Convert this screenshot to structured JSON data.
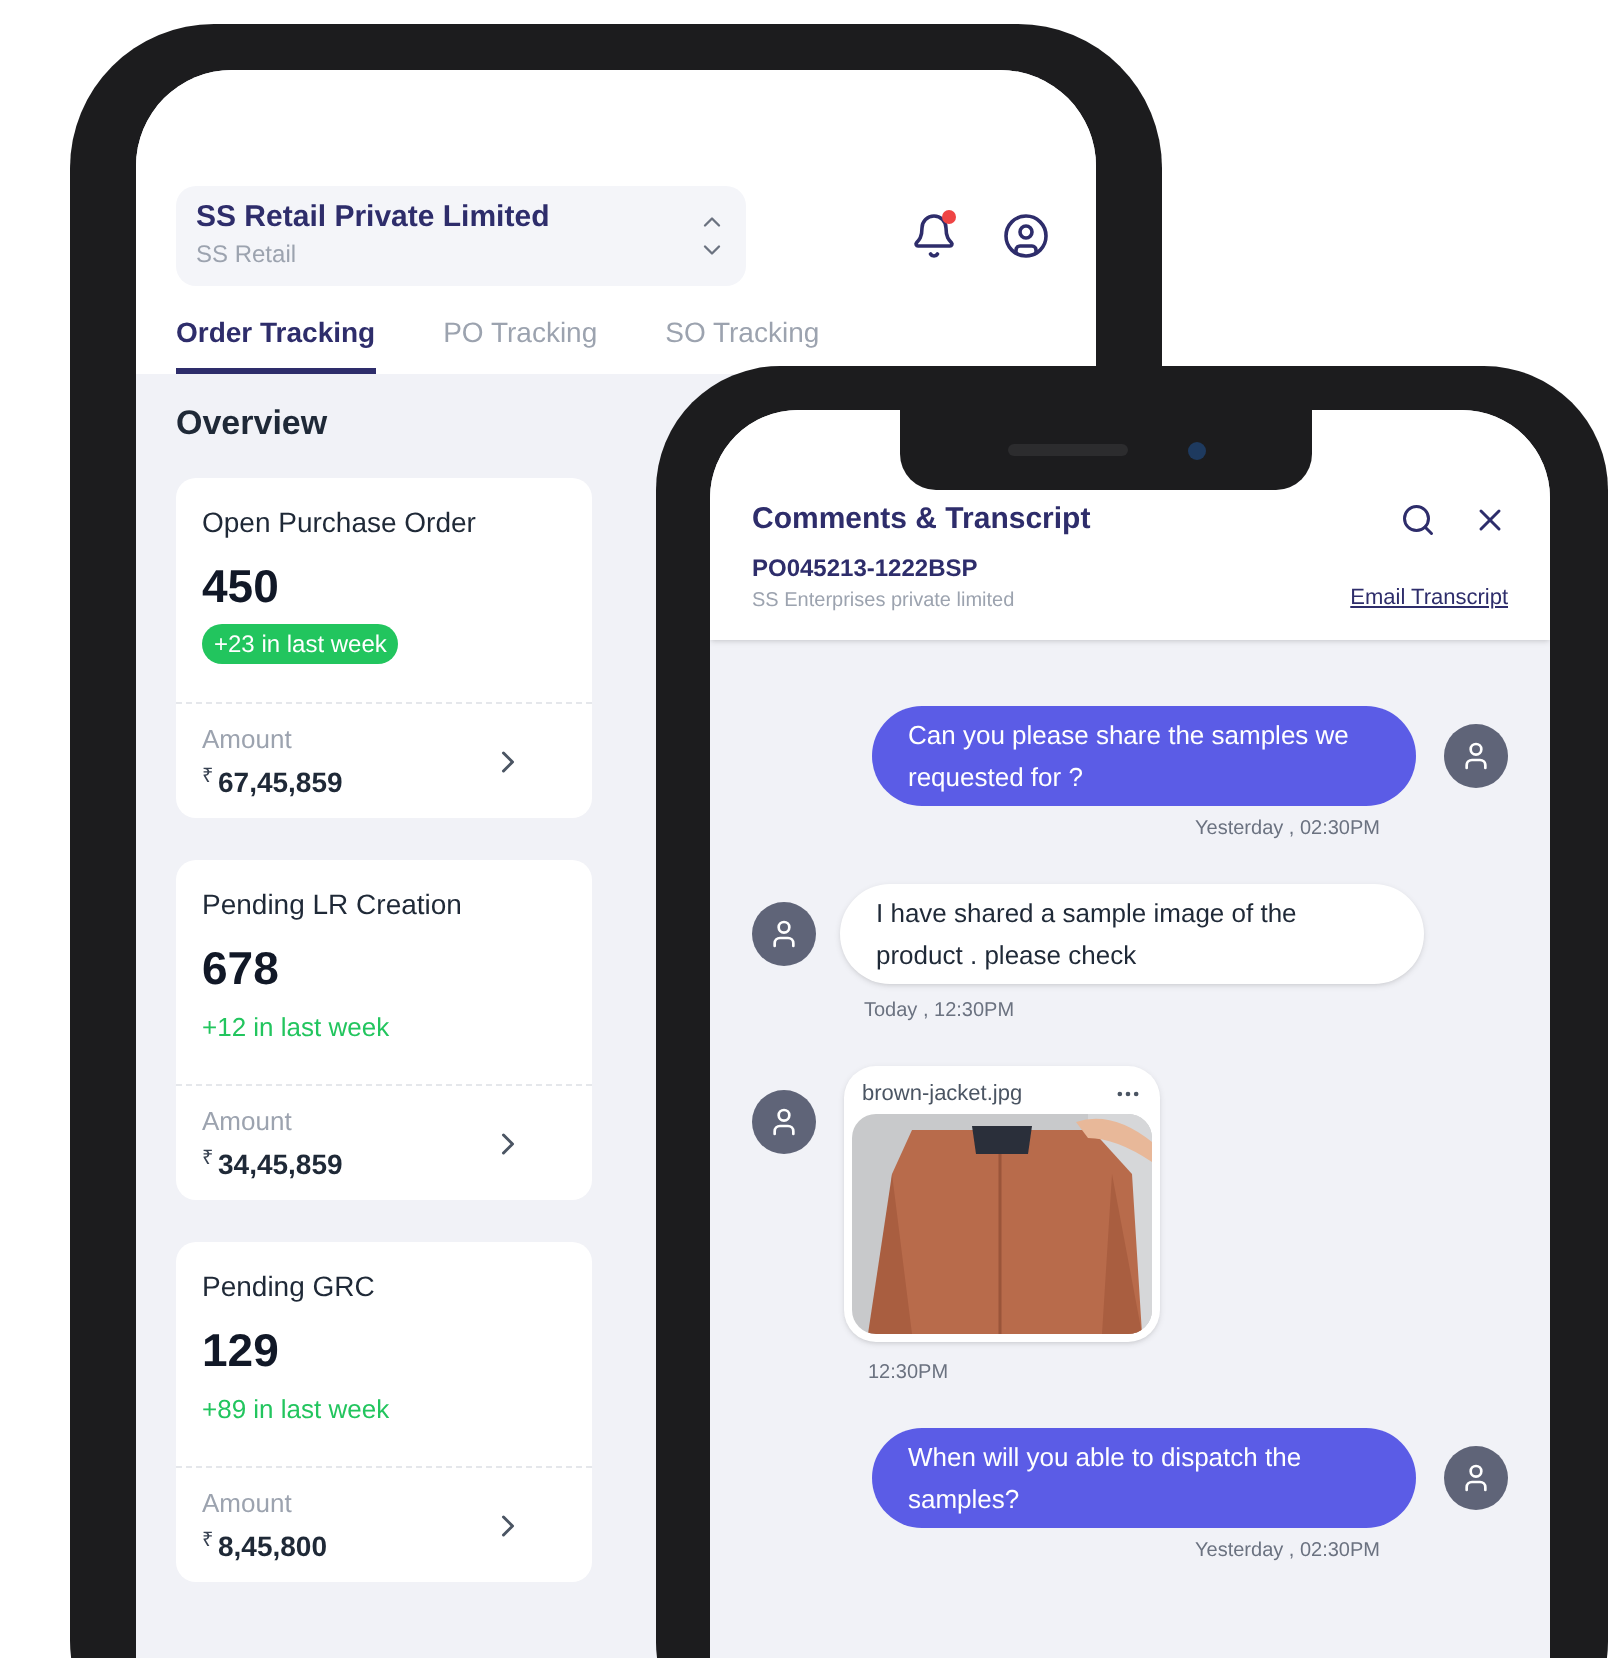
{
  "org_selector": {
    "name": "SS Retail Private Limited",
    "subtitle": "SS Retail"
  },
  "notifications": {
    "unread": true
  },
  "tabs": [
    {
      "label": "Order Tracking",
      "selected": true
    },
    {
      "label": "PO Tracking",
      "selected": false
    },
    {
      "label": "SO Tracking",
      "selected": false
    }
  ],
  "overview": {
    "title": "Overview",
    "cards": [
      {
        "title": "Open Purchase Order",
        "count": "450",
        "change": "+23 in last week",
        "highlighted": true,
        "amount_label": "Amount",
        "currency": "₹",
        "amount": "67,45,859"
      },
      {
        "title": "Pending LR Creation",
        "count": "678",
        "change": "+12 in last week",
        "highlighted": false,
        "amount_label": "Amount",
        "currency": "₹",
        "amount": "34,45,859"
      },
      {
        "title": "Pending GRC",
        "count": "129",
        "change": "+89 in last week",
        "highlighted": false,
        "amount_label": "Amount",
        "currency": "₹",
        "amount": "8,45,800"
      }
    ]
  },
  "chat": {
    "title": "Comments & Transcript",
    "order_id": "PO045213-1222BSP",
    "company": "SS Enterprises private limited",
    "email_link": "Email Transcript",
    "messages": [
      {
        "kind": "sent",
        "text": "Can you please share the samples we requested for ?",
        "time": "Yesterday , 02:30PM"
      },
      {
        "kind": "received",
        "text": "I have shared a sample image of the product . please check",
        "time": "Today , 12:30PM"
      },
      {
        "filename": "brown-jacket.jpg",
        "time": "12:30PM"
      },
      {
        "kind": "sent",
        "text": "When will you able to dispatch the samples?",
        "time": "Yesterday , 02:30PM"
      }
    ]
  }
}
